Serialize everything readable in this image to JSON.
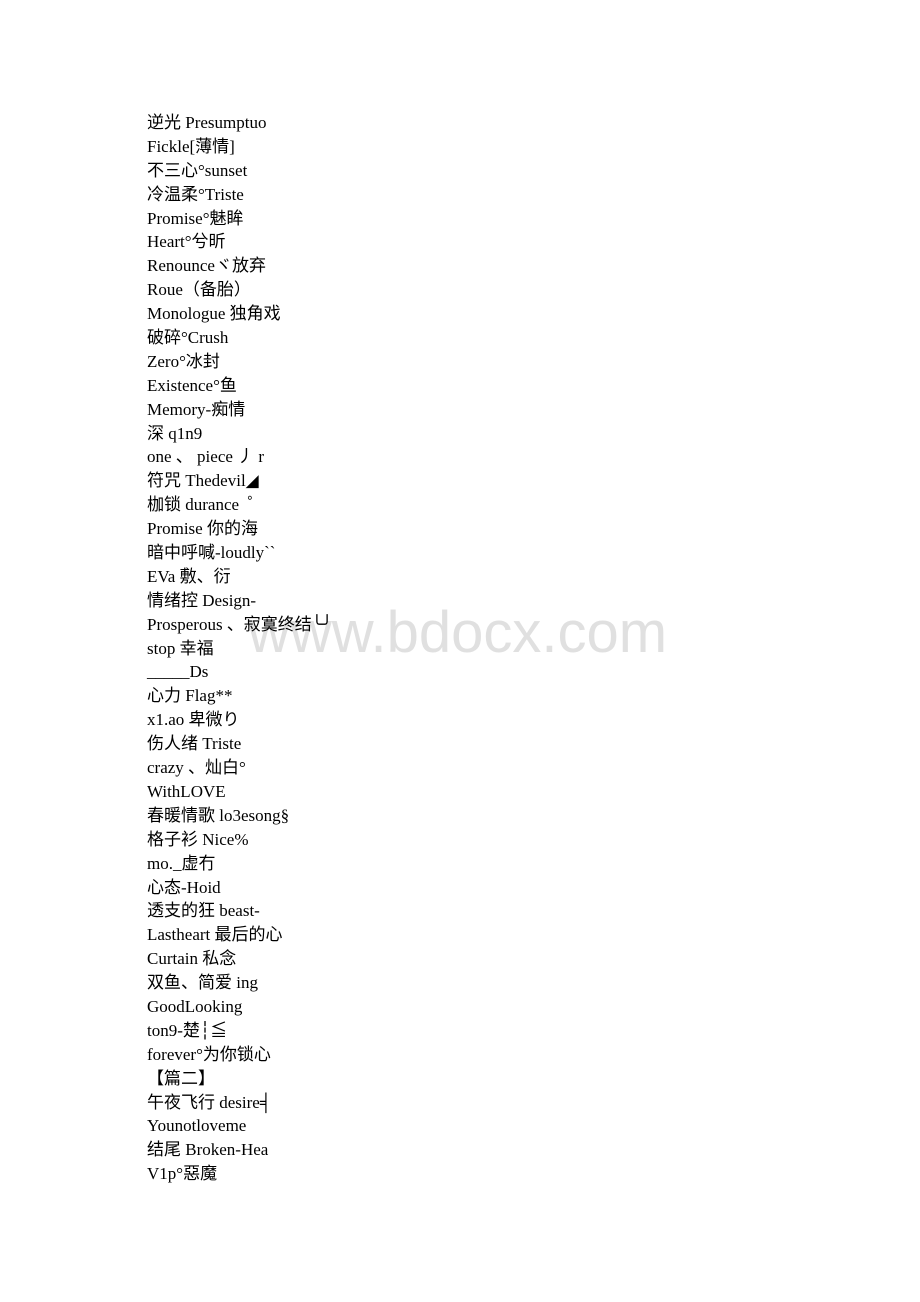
{
  "document": {
    "lines": [
      "逆光 Presumptuo",
      "Fickle[薄情]",
      "不三心°sunset",
      "冷温柔°Triste",
      "Promise°魅眸",
      "Heart°兮昕",
      "Renounceヾ放弃",
      "Roue（备胎）",
      "Monologue 独角戏",
      "破碎°Crush",
      "Zero°冰封",
      "Existence°鱼",
      "Memory-痴情",
      "深 q1n9",
      "one 、 piece 丿 r",
      "符咒 Thedevil◢",
      "枷锁 durance  ゜",
      "Promise 你的海",
      "暗中呼喊-loudly``",
      "EVa 敷、衍",
      "情绪控 Design-",
      "Prosperous 、寂寞终结╰╯",
      "stop 幸福",
      "_____Ds",
      "心力 Flag**",
      "x1.ao 卑微り",
      "伤人绪 Triste",
      "crazy 、灿白°",
      "WithLOVE",
      "春暖情歌 lo3esong§",
      "格子衫 Nice%",
      "mo._虚冇",
      "心态-Hoid",
      "透支的狂 beast-",
      "Lastheart 最后的心",
      "Curtain 私念",
      "双鱼、简爱 ing",
      "GoodLooking",
      "ton9-楚┆≦",
      "forever°为你锁心",
      "【篇二】",
      "午夜飞行 desire╡",
      "Younotloveme",
      "结尾 Broken-Hea",
      "V1p°惡魔"
    ]
  },
  "watermark": {
    "text": "www.bdocx.com",
    "color": "#e0e0e0"
  }
}
